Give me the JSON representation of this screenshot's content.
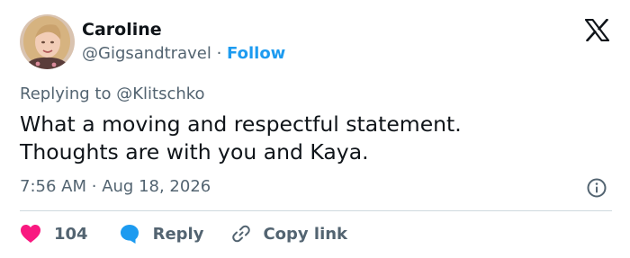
{
  "user": {
    "name": "Caroline",
    "handle": "@Gigsandtravel",
    "separator": "·",
    "follow_label": "Follow"
  },
  "reply_context": "Replying to @Klitschko",
  "tweet_lines": [
    "What a moving and respectful statement.",
    "Thoughts are with you and Kaya."
  ],
  "meta": {
    "time": "7:56 AM",
    "separator": "·",
    "date": "Aug 18, 2026"
  },
  "actions": {
    "like_count": "104",
    "reply_label": "Reply",
    "copy_link_label": "Copy link"
  },
  "icons": {
    "platform": "x-logo-icon",
    "info": "info-icon",
    "like": "heart-icon",
    "reply": "speech-bubble-icon",
    "copy": "link-icon"
  },
  "colors": {
    "text": "#0f1419",
    "secondary": "#536471",
    "accent": "#1d9bf0",
    "like": "#f91880",
    "divider": "#cfd9de"
  }
}
